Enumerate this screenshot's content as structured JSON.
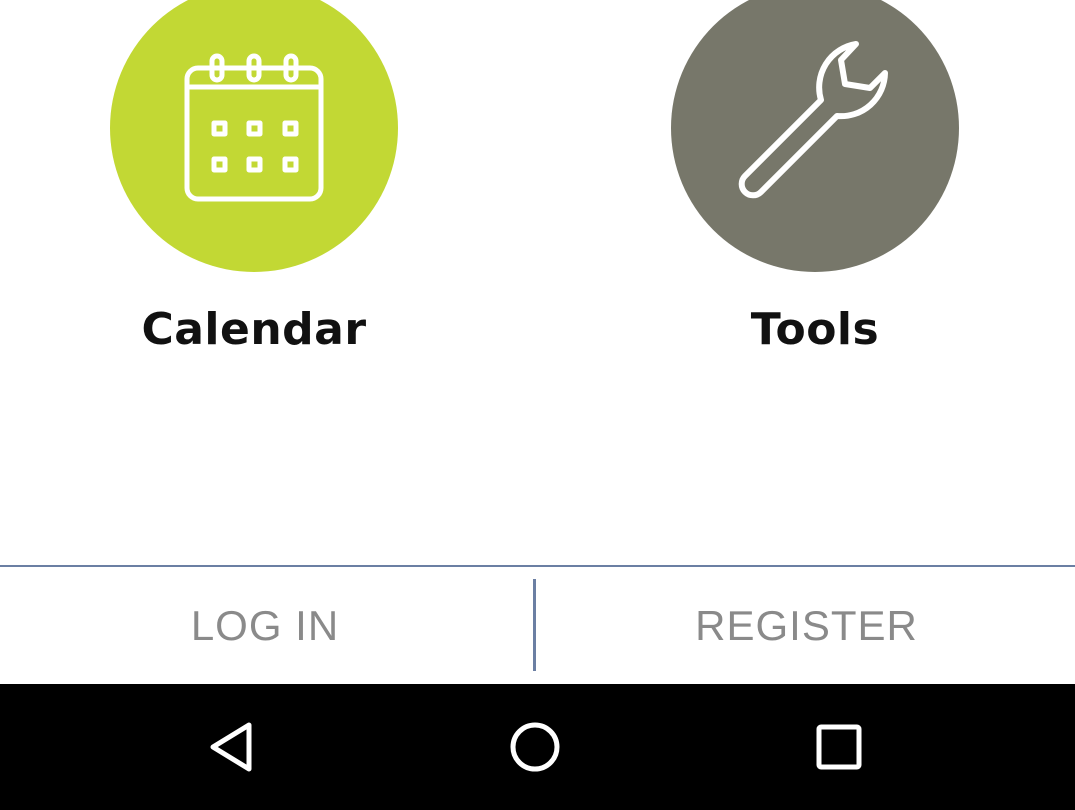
{
  "tiles": [
    {
      "label": "Calendar",
      "icon": "calendar-icon",
      "color": "#c2d834"
    },
    {
      "label": "Tools",
      "icon": "wrench-icon",
      "color": "#77776a"
    }
  ],
  "auth": {
    "login_label": "LOG IN",
    "register_label": "REGISTER",
    "accent_color": "#6b7fa3"
  },
  "navbar": {
    "back_icon": "back-triangle-icon",
    "home_icon": "home-circle-icon",
    "recents_icon": "recents-square-icon"
  }
}
